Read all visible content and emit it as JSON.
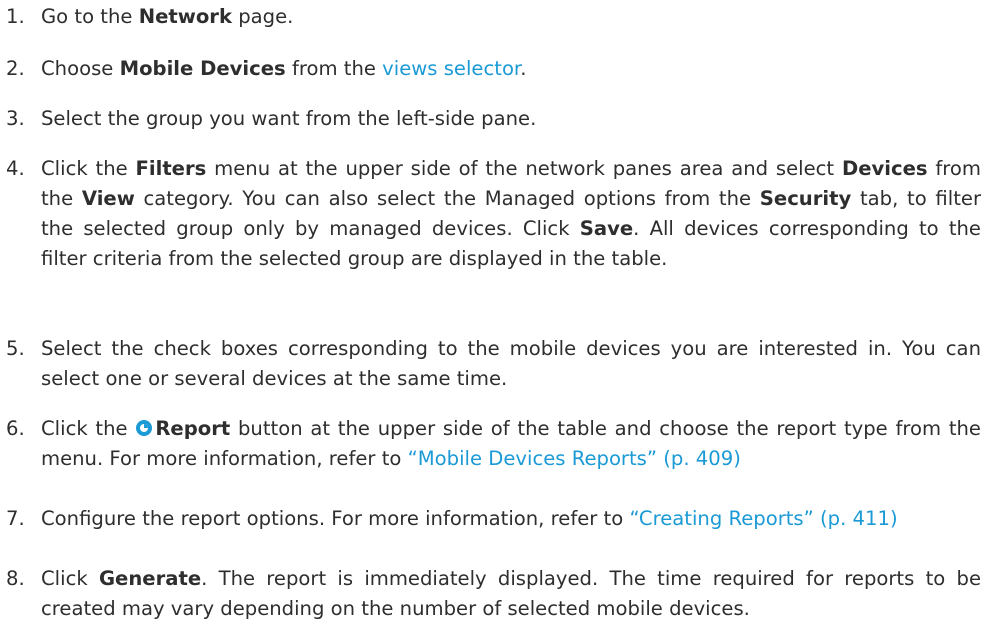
{
  "steps": [
    {
      "number": "1.",
      "t1": "Go to the ",
      "b1": "Network",
      "t2": " page."
    },
    {
      "number": "2.",
      "t1": "Choose ",
      "b1": "Mobile Devices",
      "t2": " from the ",
      "link1": "views selector",
      "t3": "."
    },
    {
      "number": "3.",
      "t1": "Select the group you want from the left-side pane."
    },
    {
      "number": "4.",
      "t1": "Click the ",
      "b1": "Filters",
      "t2": " menu at the upper side of the network panes area and select ",
      "b2": "Devices",
      "t3": " from the ",
      "b3": "View",
      "t4": " category. You can also select the Managed options from the ",
      "b4": "Security",
      "t5": " tab, to filter the selected group only by managed devices. Click ",
      "b5": "Save",
      "t6": ". All devices corresponding to the filter criteria from the selected group are displayed in the table."
    },
    {
      "number": "5.",
      "t1": "Select the check boxes corresponding to the mobile devices you are interested in. You can select one or several devices at the same time."
    },
    {
      "number": "6.",
      "t1": "Click the ",
      "icon": "report-icon",
      "b1": "Report",
      "t2": " button at the upper side of the table and choose the report type from the menu. For more information, refer to ",
      "link1": "“Mobile Devices Reports” (p. 409)"
    },
    {
      "number": "7.",
      "t1": "Configure the report options. For more information, refer to ",
      "link1": "“Creating Reports” (p. 411)"
    },
    {
      "number": "8.",
      "t1": "Click ",
      "b1": "Generate",
      "t2": ". The report is immediately displayed. The time required for reports to be created may vary depending on the number of selected mobile devices."
    }
  ],
  "colors": {
    "text": "#2e2e2e",
    "link": "#1b9ad6"
  }
}
